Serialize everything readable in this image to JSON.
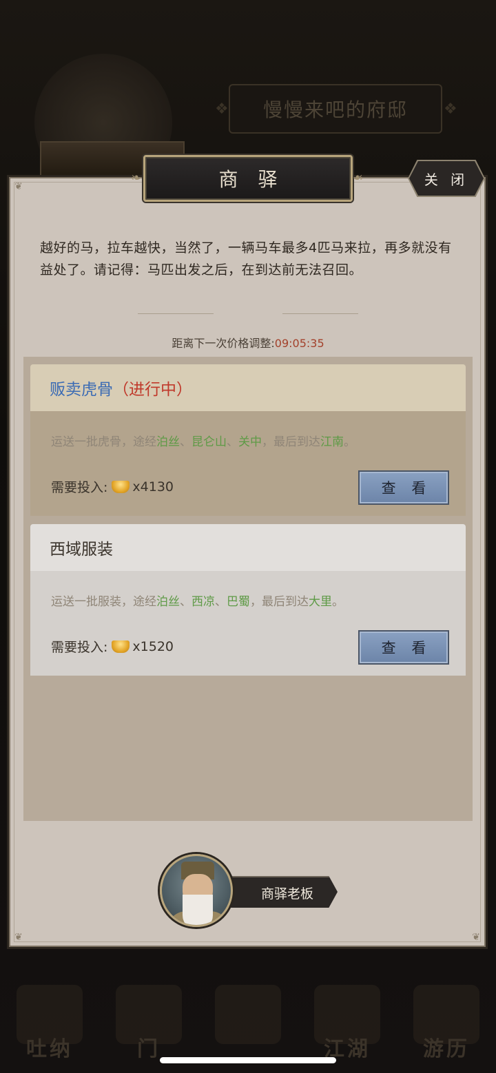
{
  "background": {
    "mansion_title": "慢慢来吧的府邸",
    "bottom_nav": [
      {
        "label": "吐纳",
        "icon": "meditation-icon"
      },
      {
        "label": "门",
        "icon": "gate-icon"
      },
      {
        "label": "",
        "icon": "scroll-icon"
      },
      {
        "label": "江湖",
        "icon": "jianghu-icon"
      },
      {
        "label": "游历",
        "icon": "travel-icon"
      }
    ]
  },
  "modal": {
    "title": "商 驿",
    "close_label": "关 闭",
    "intro_text": "越好的马，拉车越快，当然了，一辆马车最多4匹马来拉，再多就没有益处了。请记得：马匹出发之后，在到达前无法召回。",
    "timer": {
      "label": "距离下一次价格调整:",
      "value": "09:05:35"
    },
    "caravans": [
      {
        "name": "贩卖虎骨",
        "status": "（进行中）",
        "route": {
          "prefix": "运送一批虎骨，途经",
          "stops": [
            "泊丝",
            "昆仑山",
            "关中"
          ],
          "sep": "、",
          "mid": "，最后到达",
          "destination": "江南",
          "suffix": "。"
        },
        "cost_label": "需要投入:",
        "cost_value": "x4130",
        "button_label": "查 看"
      },
      {
        "name": "西域服装",
        "status": "",
        "route": {
          "prefix": "运送一批服装，途经",
          "stops": [
            "泊丝",
            "西凉",
            "巴蜀"
          ],
          "sep": "、",
          "mid": "，最后到达",
          "destination": "大里",
          "suffix": "。"
        },
        "cost_label": "需要投入:",
        "cost_value": "x1520",
        "button_label": "查 看"
      }
    ],
    "npc_label": "商驿老板"
  },
  "colors": {
    "active_title": "#3b6bb4",
    "status_red": "#c0392b",
    "place_green": "#5e9a46",
    "timer_red": "#a3412b",
    "button_blue": "#7a92b6"
  }
}
